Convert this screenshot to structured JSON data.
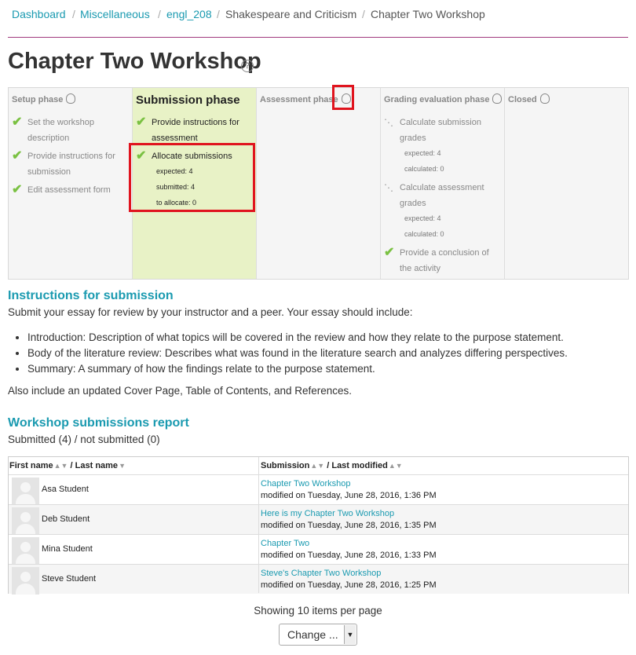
{
  "breadcrumb": {
    "items": [
      "Dashboard",
      "Miscellaneous",
      "engl_208",
      "Shakespeare and Criticism",
      "Chapter Two Workshop"
    ],
    "separator": "/"
  },
  "page": {
    "title": "Chapter Two Workshop",
    "help_glyph": "?"
  },
  "phases": {
    "setup": {
      "label": "Setup phase",
      "tasks": [
        "Set the workshop description",
        "Provide instructions for submission",
        "Edit assessment form"
      ]
    },
    "submission": {
      "label": "Submission phase",
      "tasks": [
        "Provide instructions for assessment",
        "Allocate submissions"
      ],
      "allocate_info": [
        "expected: 4",
        "submitted: 4",
        "to allocate: 0"
      ]
    },
    "assessment": {
      "label": "Assessment phase"
    },
    "grading": {
      "label": "Grading evaluation phase",
      "tasks": [
        "Calculate submission grades",
        "Calculate assessment grades",
        "Provide a conclusion of the activity"
      ],
      "submission_info": [
        "expected: 4",
        "calculated: 0"
      ],
      "assessment_info": [
        "expected: 4",
        "calculated: 0"
      ]
    },
    "closed": {
      "label": "Closed"
    }
  },
  "instructions": {
    "heading": "Instructions for submission",
    "intro": "Submit your essay for review by your instructor and a peer. Your essay should include:",
    "bullets": [
      "Introduction: Description of what topics will be covered in the review and how they relate to the purpose statement.",
      "Body of the literature review: Describes what was found in the literature search and analyzes differing perspectives.",
      "Summary: A summary of how the findings relate to the purpose statement."
    ],
    "footer": "Also include an updated Cover Page, Table of Contents, and References."
  },
  "report": {
    "heading": "Workshop submissions report",
    "summary": "Submitted (4) / not submitted (0)",
    "columns": {
      "first_name": "First name",
      "last_name": "/ Last name",
      "submission": "Submission",
      "last_modified": "/ Last modified"
    },
    "rows": [
      {
        "name": "Asa Student",
        "title": "Chapter Two Workshop",
        "modified": "modified on Tuesday, June 28, 2016, 1:36 PM"
      },
      {
        "name": "Deb Student",
        "title": "Here is my Chapter Two Workshop",
        "modified": "modified on Tuesday, June 28, 2016, 1:35 PM"
      },
      {
        "name": "Mina Student",
        "title": "Chapter Two",
        "modified": "modified on Tuesday, June 28, 2016, 1:33 PM"
      },
      {
        "name": "Steve Student",
        "title": "Steve's Chapter Two Workshop",
        "modified": "modified on Tuesday, June 28, 2016, 1:25 PM"
      }
    ]
  },
  "paging": {
    "showing": "Showing 10 items per page",
    "change_label": "Change ..."
  },
  "colors": {
    "accent": "#1a9ab0",
    "active_phase": "#e8f2c6",
    "check": "#7ac142",
    "highlight": "#e0141e",
    "rule": "#a23a7e"
  }
}
